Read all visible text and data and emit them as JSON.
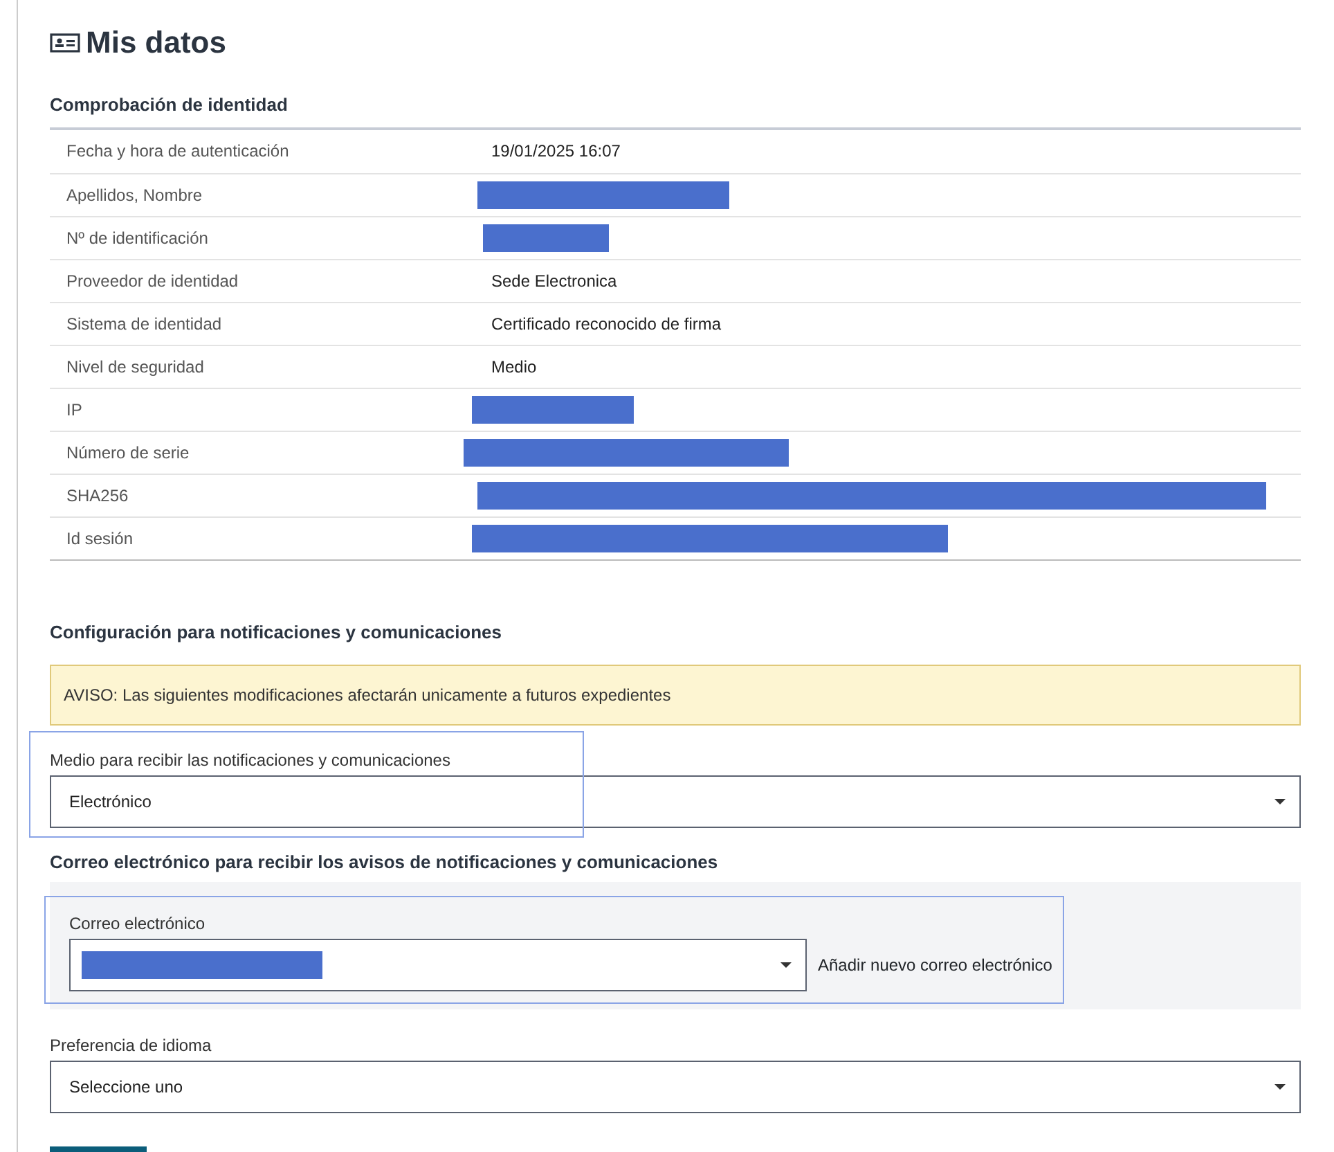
{
  "title": "Mis datos",
  "identity": {
    "heading": "Comprobación de identidad",
    "rows": [
      {
        "label": "Fecha y hora de autenticación",
        "kind": "text",
        "value": "19/01/2025 16:07"
      },
      {
        "label": "Apellidos, Nombre",
        "kind": "redacted"
      },
      {
        "label": "Nº de identificación",
        "kind": "redacted"
      },
      {
        "label": "Proveedor de identidad",
        "kind": "text",
        "value": "Sede Electronica"
      },
      {
        "label": "Sistema de identidad",
        "kind": "text",
        "value": "Certificado reconocido de firma"
      },
      {
        "label": "Nivel de seguridad",
        "kind": "text",
        "value": "Medio"
      },
      {
        "label": "IP",
        "kind": "redacted"
      },
      {
        "label": "Número de serie",
        "kind": "redacted"
      },
      {
        "label": "SHA256",
        "kind": "redacted"
      },
      {
        "label": "Id sesión",
        "kind": "redacted"
      }
    ]
  },
  "notifications": {
    "heading": "Configuración para notificaciones y comunicaciones",
    "alert": "AVISO: Las siguientes modificaciones afectarán unicamente a futuros expedientes",
    "medium": {
      "label": "Medio para recibir las notificaciones y comunicaciones",
      "value": "Electrónico",
      "highlighted": true
    }
  },
  "email": {
    "heading": "Correo electrónico para recibir los avisos de notificaciones y comunicaciones",
    "label": "Correo electrónico",
    "redacted": true,
    "highlighted": true,
    "add_link": "Añadir nuevo correo electrónico"
  },
  "language": {
    "label": "Preferencia de idioma",
    "value": "Seleccione uno"
  }
}
